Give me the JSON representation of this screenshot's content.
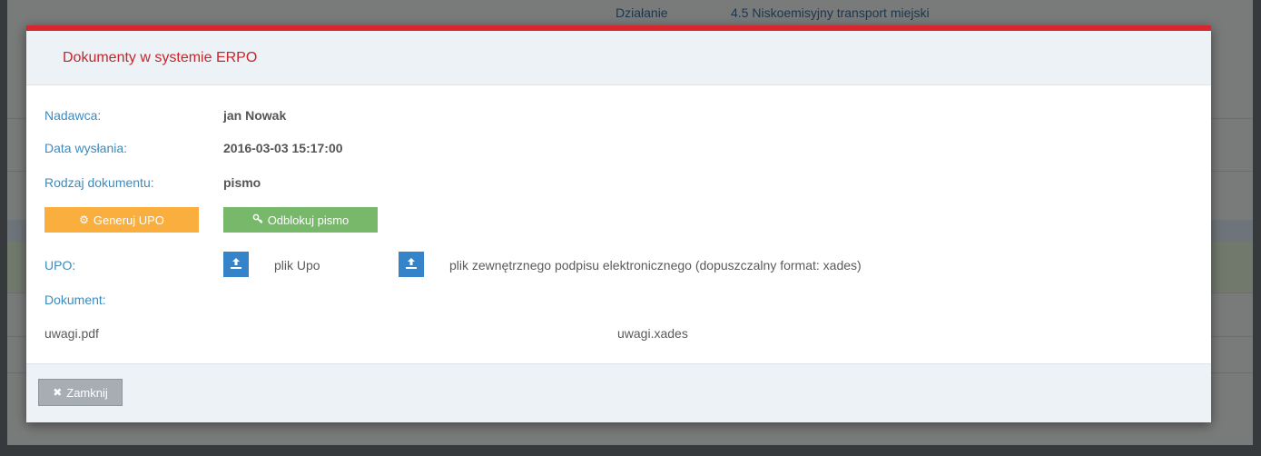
{
  "background": {
    "row1_label": "Działanie",
    "row1_value": "4.5 Niskoemisyjny transport miejski"
  },
  "modal": {
    "title": "Dokumenty w systemie ERPO",
    "sender_label": "Nadawca:",
    "sender_value": "jan Nowak",
    "sent_date_label": "Data wysłania:",
    "sent_date_value": "2016-03-03 15:17:00",
    "doc_type_label": "Rodzaj dokumentu:",
    "doc_type_value": "pismo",
    "generate_upo_label": "Generuj UPO",
    "unlock_label": "Odblokuj pismo",
    "upo_label": "UPO:",
    "upo_file_label": "plik Upo",
    "external_sig_label": "plik zewnętrznego podpisu elektronicznego (dopuszczalny format: xades)",
    "document_label": "Dokument:",
    "document_file": "uwagi.pdf",
    "signature_file": "uwagi.xades",
    "close_label": "Zamknij"
  },
  "colors": {
    "accent_red": "#d9252e",
    "label_blue": "#3b8bbf",
    "orange": "#f9ae3d",
    "green": "#77b86b",
    "upload_blue": "#3583c8"
  },
  "icons": {
    "generate": "gear-icon",
    "unlock": "key-icon",
    "upload": "upload-icon",
    "close": "close-icon"
  }
}
